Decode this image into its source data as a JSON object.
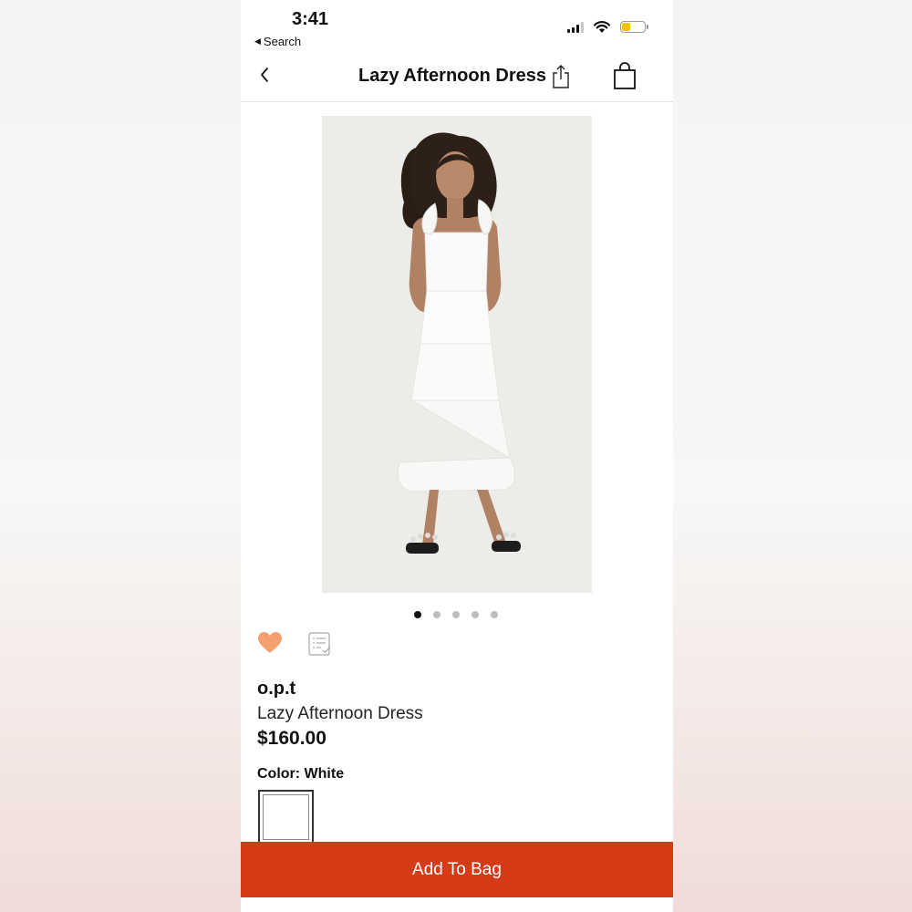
{
  "status_bar": {
    "time": "3:41",
    "back_label": "Search",
    "battery_level": 0.35,
    "battery_color": "#f5c400"
  },
  "nav": {
    "title": "Lazy Afternoon Dress",
    "back_icon": "chevron-left-icon",
    "share_icon": "share-icon",
    "bag_icon": "shopping-bag-icon"
  },
  "gallery": {
    "image_count": 5,
    "active_index": 0
  },
  "product": {
    "brand": "o.p.t",
    "name": "Lazy Afternoon Dress",
    "price": "$160.00",
    "color_label": "Color: White",
    "favorite_icon": "heart-icon",
    "favorite_color": "#f4a070",
    "wishlist_icon": "checklist-icon"
  },
  "cta": {
    "add_to_bag_label": "Add To Bag",
    "color": "#d63b18"
  }
}
